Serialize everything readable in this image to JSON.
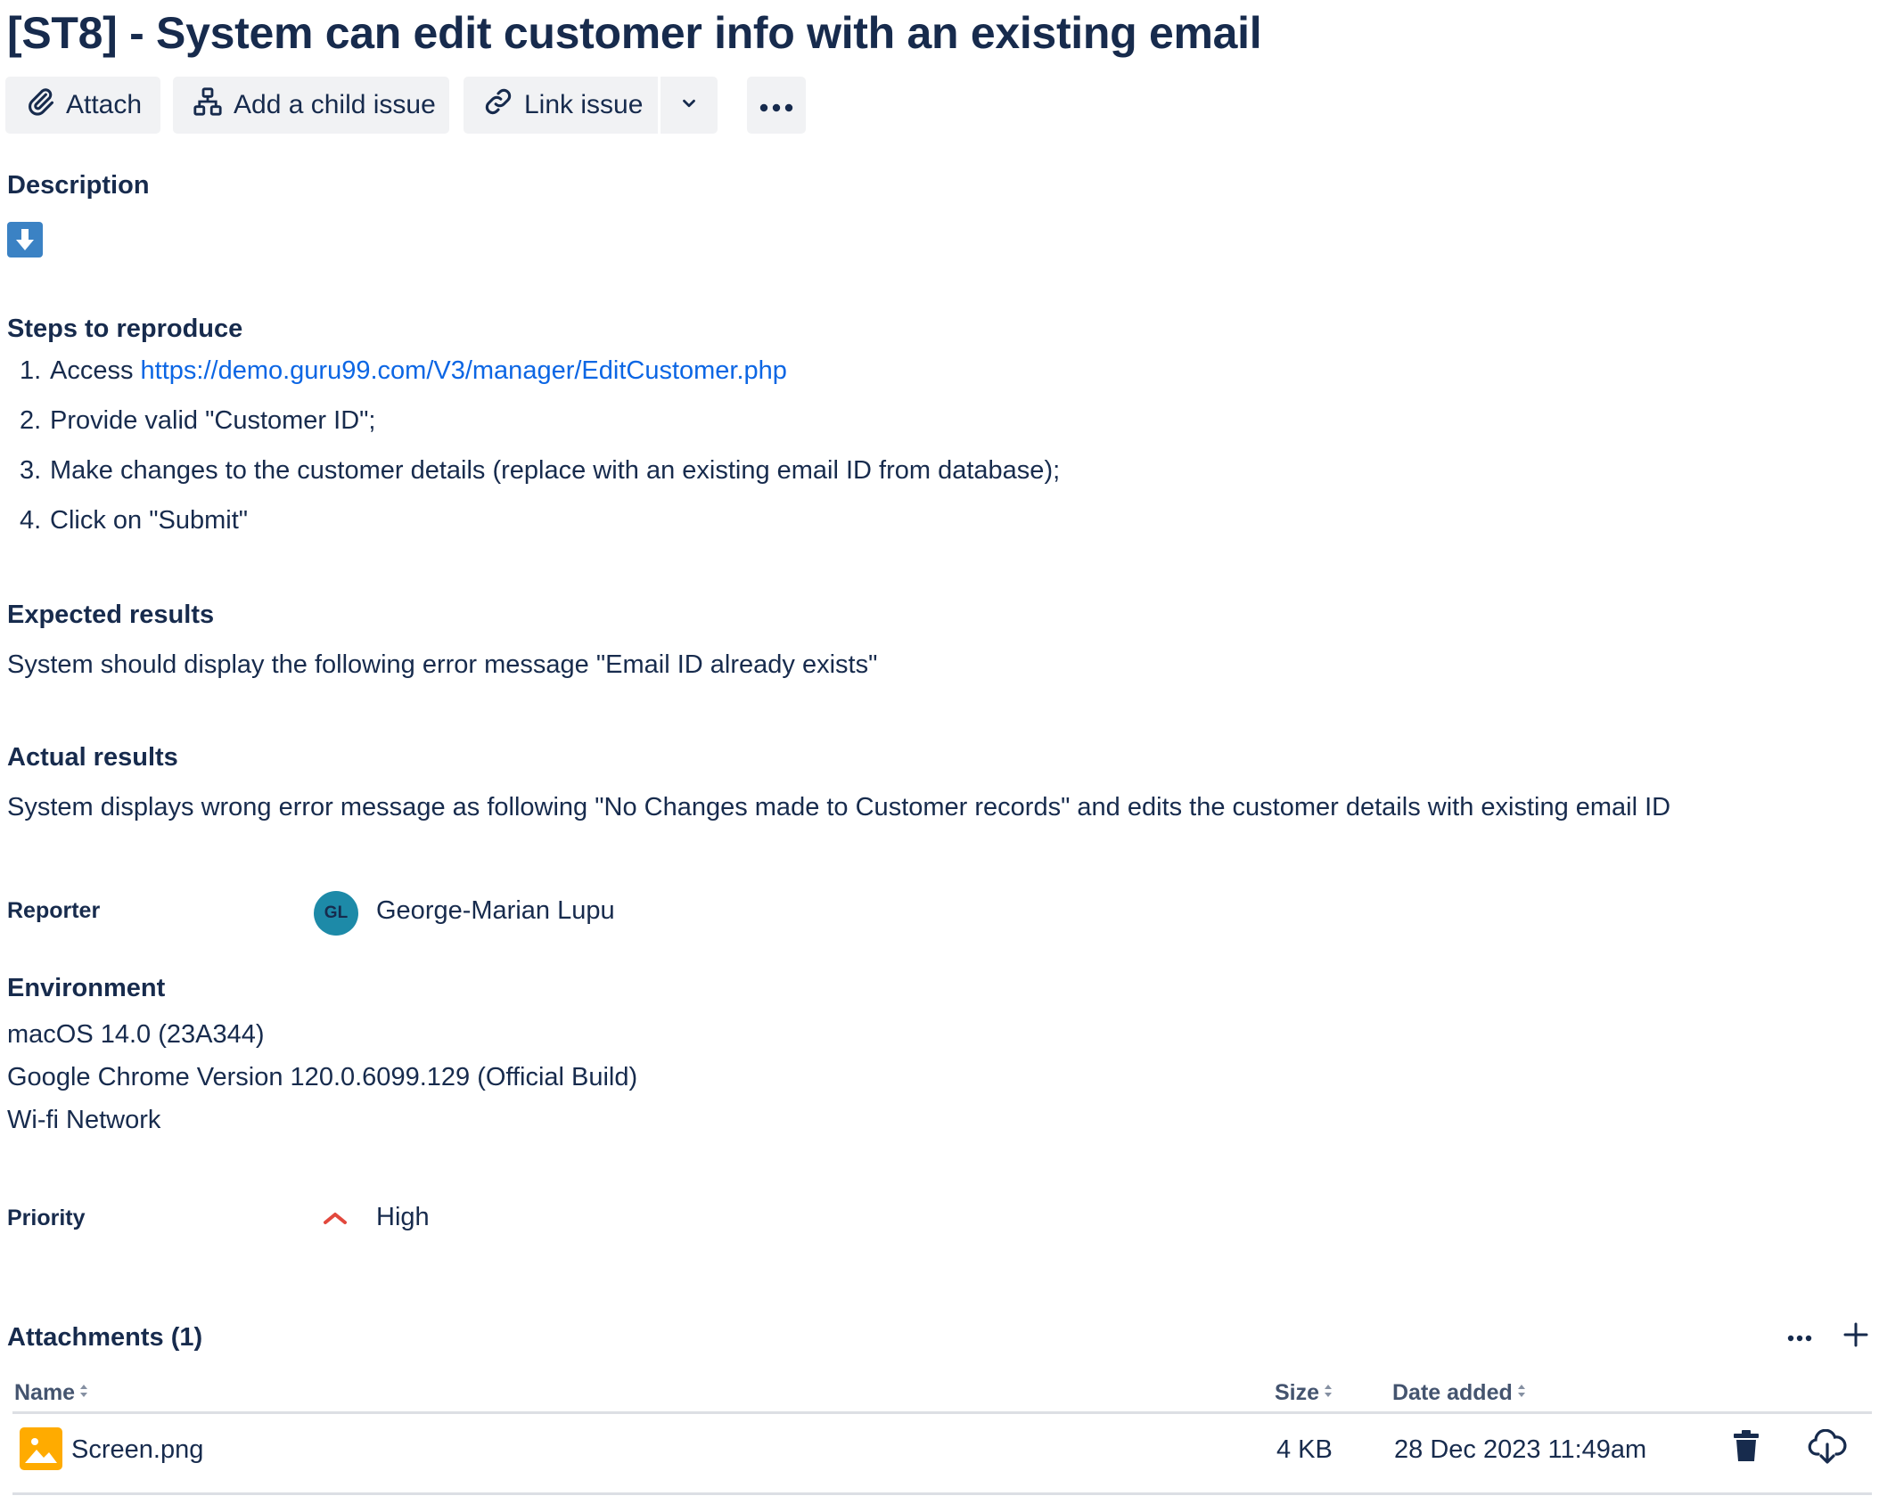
{
  "issue": {
    "title": "[ST8] - System can edit customer info with an existing email"
  },
  "toolbar": {
    "attach_label": "Attach",
    "child_label": "Add a child issue",
    "link_label": "Link issue"
  },
  "description": {
    "heading": "Description",
    "steps_heading": "Steps to reproduce",
    "steps": [
      {
        "num": "1.",
        "text": "Access ",
        "link": "https://demo.guru99.com/V3/manager/EditCustomer.php"
      },
      {
        "num": "2.",
        "text": "Provide valid \"Customer ID\";"
      },
      {
        "num": "3.",
        "text": "Make changes to the customer details (replace with an existing email ID from database);"
      },
      {
        "num": "4.",
        "text": "Click on \"Submit\""
      }
    ],
    "expected_heading": "Expected results",
    "expected_text": "System should display the following error message \"Email ID already exists\"",
    "actual_heading": "Actual results",
    "actual_text": "System displays wrong error message as following \"No Changes made to Customer records\" and edits the customer details with existing email ID"
  },
  "reporter": {
    "label": "Reporter",
    "initials": "GL",
    "name": "George-Marian Lupu",
    "avatar_color": "#1d8aa8"
  },
  "environment": {
    "heading": "Environment",
    "lines": [
      "macOS 14.0 (23A344)",
      "Google Chrome Version 120.0.6099.129 (Official Build)",
      "Wi-fi Network"
    ]
  },
  "priority": {
    "label": "Priority",
    "value": "High",
    "icon": "priority-high-icon",
    "color": "#e2483d"
  },
  "attachments": {
    "heading": "Attachments (1)",
    "columns": {
      "name": "Name",
      "size": "Size",
      "date": "Date added"
    },
    "rows": [
      {
        "name": "Screen.png",
        "size": "4 KB",
        "date": "28 Dec 2023 11:49am"
      }
    ]
  },
  "colors": {
    "text": "#172b4d",
    "link": "#0c66e4",
    "button_bg": "#f1f2f4",
    "image_icon": "#ffab00"
  }
}
